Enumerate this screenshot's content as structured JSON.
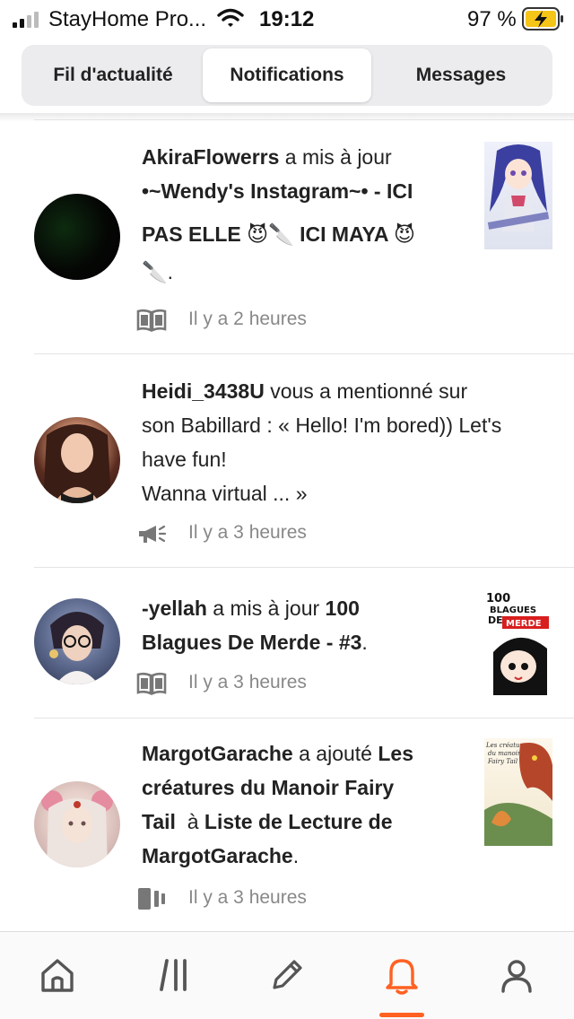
{
  "status_bar": {
    "carrier": "StayHome Pro...",
    "time": "19:12",
    "battery": "97 %",
    "icons": [
      "signal-icon",
      "wifi-icon",
      "battery-charging-icon"
    ]
  },
  "tabs": [
    {
      "label": "Fil d'actualité",
      "active": false
    },
    {
      "label": "Notifications",
      "active": true
    },
    {
      "label": "Messages",
      "active": false
    }
  ],
  "notifications": [
    {
      "user": "AkiraFlowerrs",
      "action": " a mis à jour ",
      "target_line1": "•~Wendy's Instagram~• - ICI",
      "target_line2": "PAS ELLE 😈🔪 ICI MAYA 😈",
      "target_line3": "🔪",
      "end": ".",
      "meta_icon": "book-icon",
      "time": "Il y a 2 heures",
      "thumbnail": "anime-girl-cover"
    },
    {
      "user": "Heidi_3438U",
      "line1_rest": " vous a mentionné sur",
      "line2": "son Babillard : « Hello! I'm bored)) Let's",
      "line3": "have fun!",
      "line4": "Wanna virtual ... »",
      "meta_icon": "megaphone-icon",
      "time": "Il y a 3 heures"
    },
    {
      "user": "-yellah",
      "action": " a mis à jour ",
      "target_line1": "100",
      "target_line2": "Blagues De Merde - #3",
      "end": ".",
      "meta_icon": "book-icon",
      "time": "Il y a 3 heures",
      "thumbnail_text": [
        "100",
        "BLAGUES",
        "DE",
        "MERDE"
      ]
    },
    {
      "user": "MargotGarache",
      "action": " a ajouté ",
      "target_line1a": "Les",
      "target_line2": "créatures du Manoir Fairy",
      "target_line3a": "Tail",
      "connector": "  à ",
      "target_line3b": "Liste de Lecture de",
      "target_line4": "MargotGarache",
      "end": ".",
      "meta_icon": "reading-list-icon",
      "time": "Il y a 3 heures",
      "thumbnail_text": [
        "Les créatures",
        "du manoir",
        "Fairy Tail"
      ]
    }
  ],
  "bottom_nav": [
    {
      "icon": "home-icon",
      "active": false
    },
    {
      "icon": "library-icon",
      "active": false
    },
    {
      "icon": "pencil-icon",
      "active": false
    },
    {
      "icon": "bell-icon",
      "active": true
    },
    {
      "icon": "profile-icon",
      "active": false
    }
  ],
  "colors": {
    "accent": "#ff6122",
    "text": "#222222",
    "muted": "#888888"
  }
}
